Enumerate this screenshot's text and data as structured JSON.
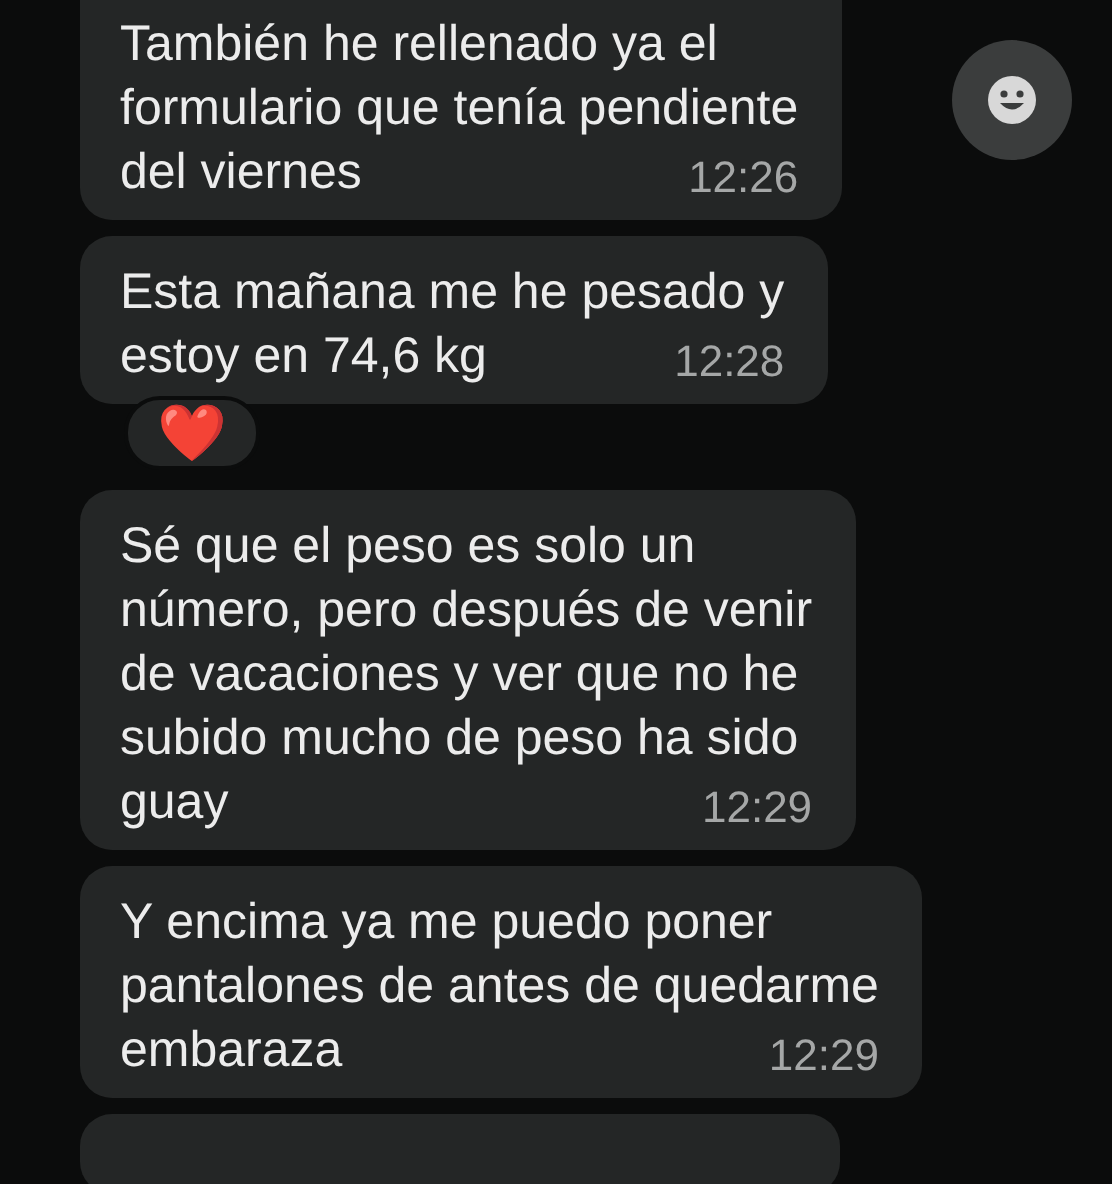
{
  "messages": [
    {
      "lines": [
        "También he rellenado ya el",
        "formulario que tenía pendiente",
        "del viernes"
      ],
      "time": "12:26",
      "cut_top": true
    },
    {
      "lines": [
        "Esta mañana me he pesado y",
        "estoy en 74,6 kg"
      ],
      "time": "12:28",
      "reaction": "❤️"
    },
    {
      "lines": [
        "Sé que el peso es solo un",
        "número, pero después de venir",
        "de vacaciones y ver que no he",
        "subido mucho de peso ha sido",
        "guay"
      ],
      "time": "12:29"
    },
    {
      "lines": [
        "Y encima ya me puedo poner",
        "pantalones de antes de quedarme",
        "embaraza"
      ],
      "time": "12:29"
    }
  ],
  "partial_bubble_below": true
}
